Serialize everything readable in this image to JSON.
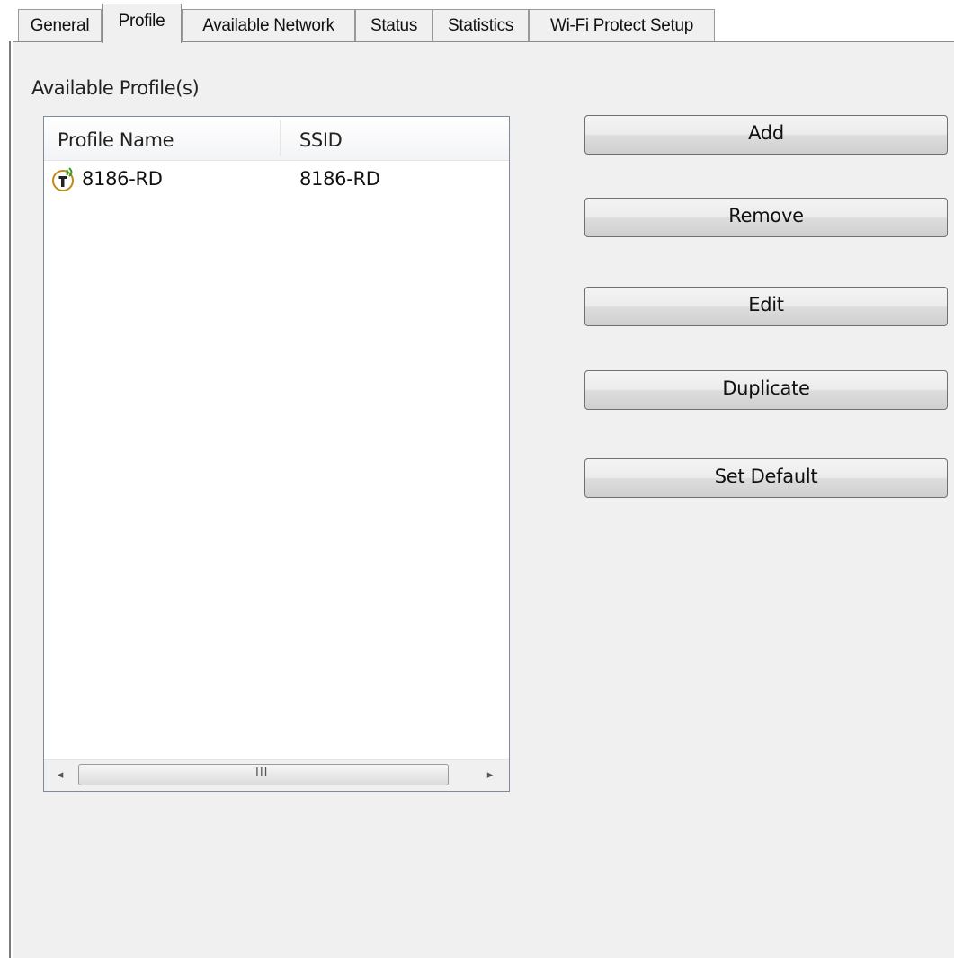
{
  "tabs": [
    {
      "label": "General",
      "selected": false
    },
    {
      "label": "Profile",
      "selected": true
    },
    {
      "label": "Available Network",
      "selected": false
    },
    {
      "label": "Status",
      "selected": false
    },
    {
      "label": "Statistics",
      "selected": false
    },
    {
      "label": "Wi-Fi Protect Setup",
      "selected": false
    }
  ],
  "profile_group": {
    "label": "Available Profile(s)"
  },
  "profile_list": {
    "columns": [
      "Profile Name",
      "SSID"
    ],
    "rows": [
      {
        "profile_name": "8186-RD",
        "ssid": "8186-RD",
        "icon": "connected-profile-icon"
      }
    ],
    "scrollbar": {
      "left_arrow": "◂",
      "right_arrow": "▸",
      "grip": "III"
    }
  },
  "buttons": {
    "add": "Add",
    "remove": "Remove",
    "edit": "Edit",
    "duplicate": "Duplicate",
    "set_default": "Set Default"
  },
  "colors": {
    "panel_background": "#f0f0f0",
    "icon_ring": "#c08a1a",
    "icon_signal": "#3a9a2a"
  }
}
